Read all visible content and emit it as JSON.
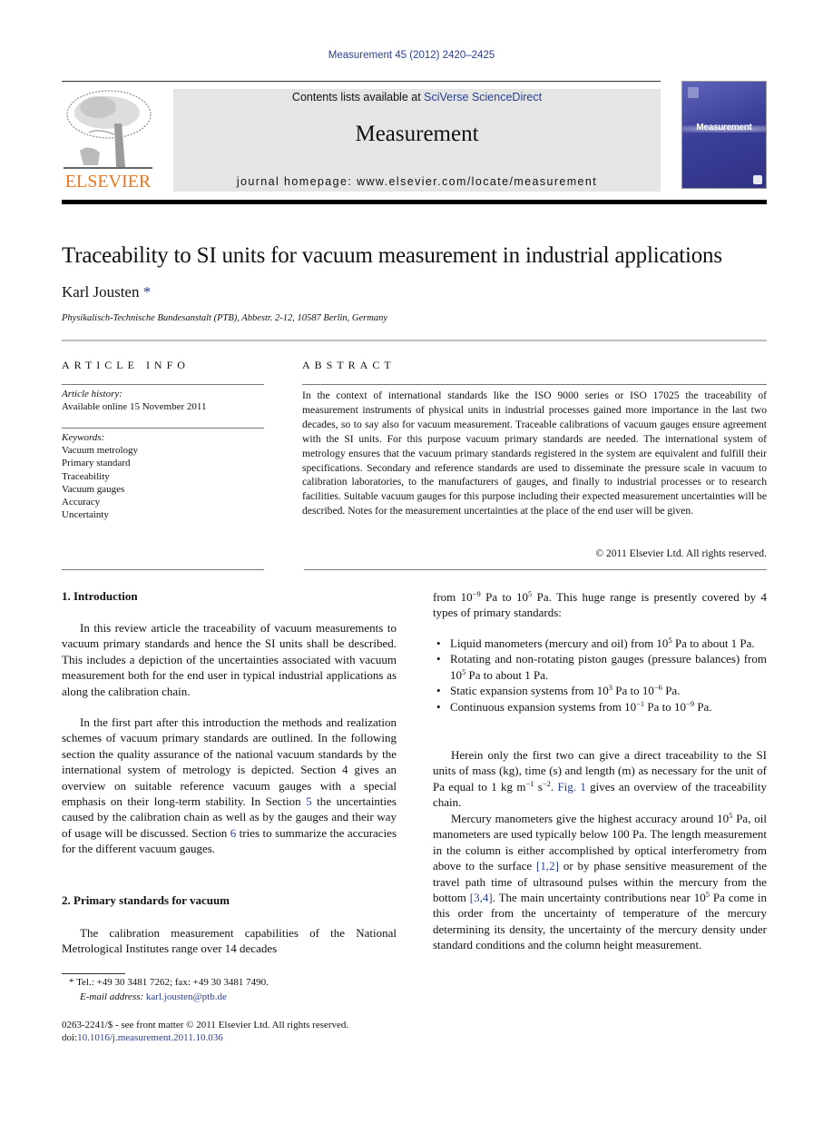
{
  "header": {
    "journal_ref": "Measurement 45 (2012) 2420–2425",
    "contents_prefix": "Contents lists available at ",
    "contents_link": "SciVerse ScienceDirect",
    "journal_title": "Measurement",
    "homepage": "journal homepage: www.elsevier.com/locate/measurement",
    "publisher_logo_text": "ELSEVIER",
    "cover_title": "Measurement"
  },
  "colors": {
    "link": "#2a3f8f",
    "elsevier_orange": "#e87722",
    "masthead_bg": "#e5e5e5",
    "cover_blue": "#3b3f98"
  },
  "article": {
    "title": "Traceability to SI units for vacuum measurement in industrial applications",
    "author": "Karl Jousten",
    "author_mark": "*",
    "affiliation": "Physikalisch-Technische Bundesanstalt (PTB), Abbestr. 2-12, 10587 Berlin, Germany"
  },
  "article_info": {
    "heading": "ARTICLE INFO",
    "history_label": "Article history:",
    "history_value": "Available online 15 November 2011",
    "keywords_label": "Keywords:",
    "keywords": [
      "Vacuum metrology",
      "Primary standard",
      "Traceability",
      "Vacuum gauges",
      "Accuracy",
      "Uncertainty"
    ]
  },
  "abstract": {
    "heading": "ABSTRACT",
    "text": "In the context of international standards like the ISO 9000 series or ISO 17025 the traceability of measurement instruments of physical units in industrial processes gained more importance in the last two decades, so to say also for vacuum measurement. Traceable calibrations of vacuum gauges ensure agreement with the SI units. For this purpose vacuum primary standards are needed. The international system of metrology ensures that the vacuum primary standards registered in the system are equivalent and fulfill their specifications. Secondary and reference standards are used to disseminate the pressure scale in vacuum to calibration laboratories, to the manufacturers of gauges, and finally to industrial processes or to research facilities. Suitable vacuum gauges for this purpose including their expected measurement uncertainties will be described. Notes for the measurement uncertainties at the place of the end user will be given.",
    "copyright": "© 2011 Elsevier Ltd. All rights reserved."
  },
  "sections": {
    "s1_heading": "1. Introduction",
    "s1_p1": "In this review article the traceability of vacuum measurements to vacuum primary standards and hence the SI units shall be described. This includes a depiction of the uncertainties associated with vacuum measurement both for the end user in typical industrial applications as along the calibration chain.",
    "s1_p2_a": "In the first part after this introduction the methods and realization schemes of vacuum primary standards are outlined. In the following section the quality assurance of the national vacuum standards by the international system of metrology is depicted. Section 4 gives an overview on suitable reference vacuum gauges with a special emphasis on their long-term stability. In Section ",
    "s1_p2_link1": "5",
    "s1_p2_b": " the uncertainties caused by the calibration chain as well as by the gauges and their way of usage will be discussed. Section ",
    "s1_p2_link2": "6",
    "s1_p2_c": " tries to summarize the accuracies for the different vacuum gauges.",
    "s2_heading": "2. Primary standards for vacuum",
    "s2_p1": "The calibration measurement capabilities of the National Metrological Institutes range over 14 decades",
    "col2_p0_a": "from 10",
    "col2_p0_sup1": "−9",
    "col2_p0_b": " Pa to 10",
    "col2_p0_sup2": "5",
    "col2_p0_c": " Pa. This huge range is presently covered by 4 types of primary standards:",
    "bullets": [
      {
        "a": "Liquid manometers (mercury and oil) from 10",
        "s1": "5",
        "b": " Pa to about 1 Pa.",
        "s2": "",
        "c": ""
      },
      {
        "a": "Rotating and non-rotating piston gauges (pressure balances) from 10",
        "s1": "5",
        "b": " Pa to about 1 Pa.",
        "s2": "",
        "c": ""
      },
      {
        "a": "Static expansion systems from 10",
        "s1": "3",
        "b": " Pa to 10",
        "s2": "−6",
        "c": " Pa."
      },
      {
        "a": "Continuous expansion systems from 10",
        "s1": "−1",
        "b": " Pa to 10",
        "s2": "−9",
        "c": " Pa."
      }
    ],
    "col2_p1_a": "Herein only the first two can give a direct traceability to the SI units of mass (kg), time (s) and length (m) as necessary for the unit of Pa equal to 1 kg m",
    "col2_p1_sup1": "−1",
    "col2_p1_b": " s",
    "col2_p1_sup2": "−2",
    "col2_p1_c": ". ",
    "col2_p1_link": "Fig. 1",
    "col2_p1_d": " gives an overview of the traceability chain.",
    "col2_p2_a": "Mercury manometers give the highest accuracy around 10",
    "col2_p2_sup1": "5",
    "col2_p2_b": " Pa, oil manometers are used typically below 100 Pa. The length measurement in the column is either accomplished by optical interferometry from above to the surface ",
    "col2_p2_link1": "[1,2]",
    "col2_p2_c": " or by phase sensitive measurement of the travel path time of ultrasound pulses within the mercury from the bottom ",
    "col2_p2_link2": "[3,4]",
    "col2_p2_d": ". The main uncertainty contributions near 10",
    "col2_p2_sup2": "5",
    "col2_p2_e": " Pa come in this order from the uncertainty of temperature of the mercury determining its density, the uncertainty of the mercury density under standard conditions and the column height measurement."
  },
  "footnotes": {
    "mark": "*",
    "tel": "Tel.: +49 30 3481 7262; fax: +49 30 3481 7490.",
    "email_label": "E-mail address: ",
    "email": "karl.jousten@ptb.de",
    "front_matter": "0263-2241/$ - see front matter © 2011 Elsevier Ltd. All rights reserved.",
    "doi_prefix": "doi:",
    "doi": "10.1016/j.measurement.2011.10.036"
  }
}
